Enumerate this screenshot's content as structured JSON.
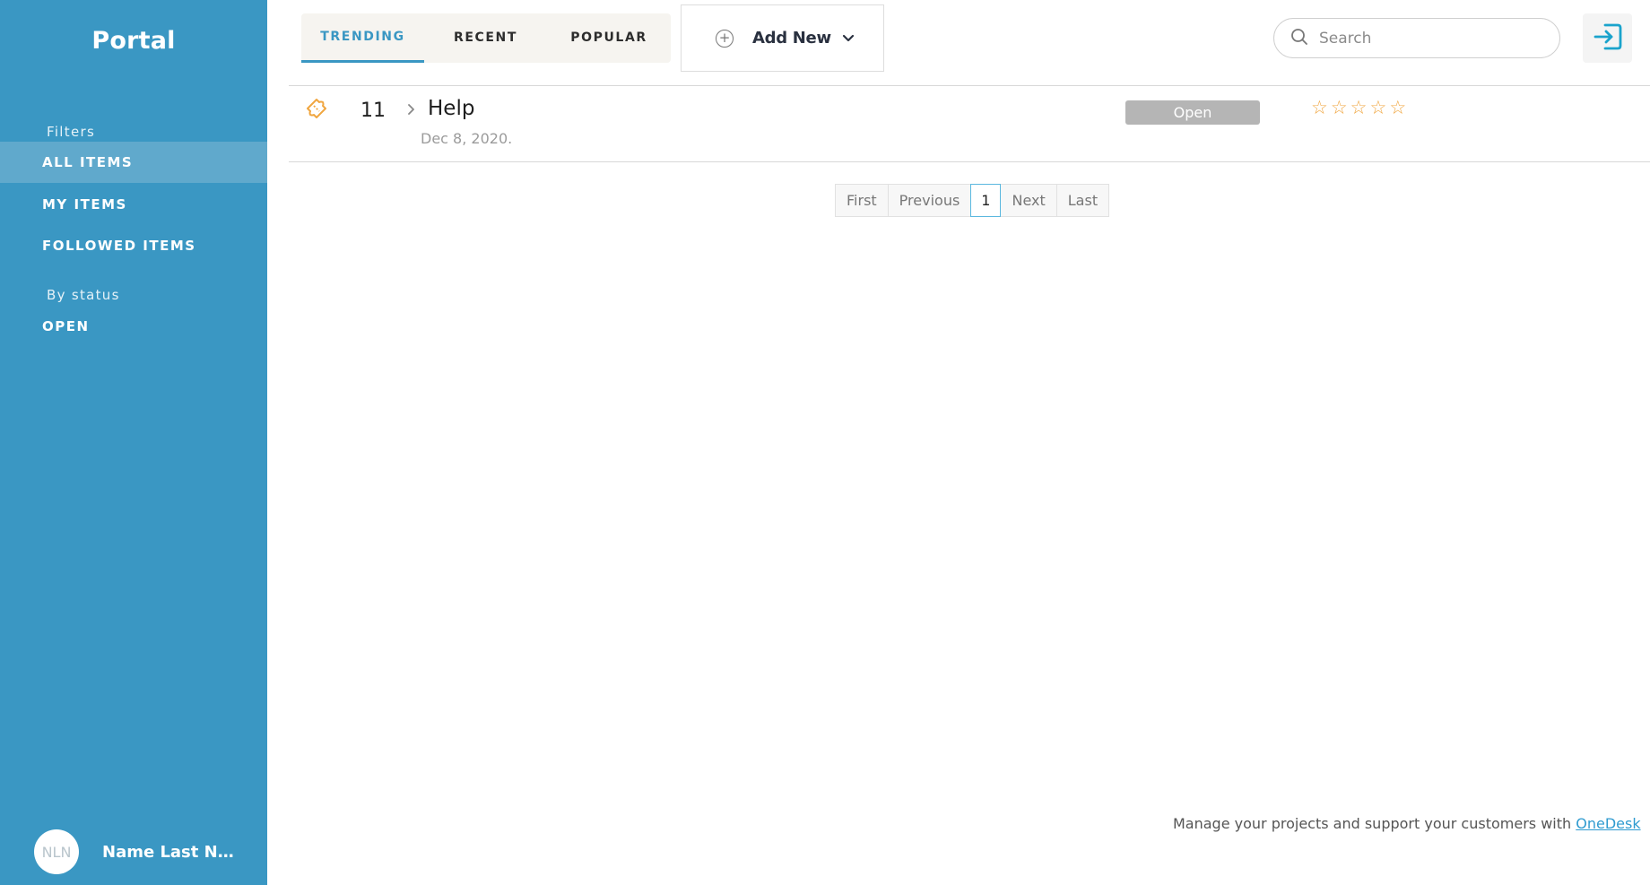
{
  "sidebar": {
    "brand": "Portal",
    "filters_label": "Filters",
    "items": [
      {
        "label": "ALL ITEMS",
        "active": true
      },
      {
        "label": "MY ITEMS",
        "active": false
      },
      {
        "label": "FOLLOWED ITEMS",
        "active": false
      }
    ],
    "status_label": "By status",
    "status_items": [
      {
        "label": "OPEN"
      }
    ],
    "user": {
      "initials": "NLN",
      "name": "Name Last Name"
    }
  },
  "header": {
    "tabs": [
      {
        "label": "TRENDING",
        "active": true
      },
      {
        "label": "RECENT",
        "active": false
      },
      {
        "label": "POPULAR",
        "active": false
      }
    ],
    "add_new_label": "Add New",
    "search_placeholder": "Search"
  },
  "items": [
    {
      "icon": "ticket-icon",
      "number": "11",
      "title": "Help",
      "date": "Dec 8, 2020.",
      "status": "Open",
      "rating": 0,
      "max_rating": 5
    }
  ],
  "pagination": {
    "first": "First",
    "previous": "Previous",
    "current": "1",
    "next": "Next",
    "last": "Last"
  },
  "footer": {
    "text": "Manage your projects and support your customers with",
    "link_text": "OneDesk"
  },
  "colors": {
    "sidebar": "#3a97c3",
    "sidebar_active": "#60a9cc",
    "accent": "#3a97c3",
    "star": "#f0a640",
    "status_badge": "#b5b5b5"
  }
}
